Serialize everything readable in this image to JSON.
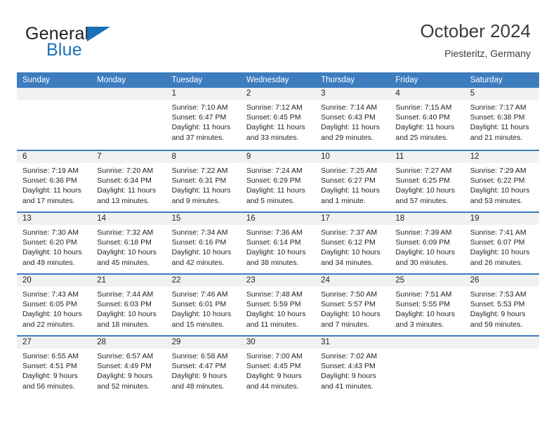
{
  "brand": {
    "name_part1": "General",
    "name_part2": "Blue",
    "accent_color": "#1a71b8"
  },
  "header": {
    "title": "October 2024",
    "location": "Piesteritz, Germany"
  },
  "calendar": {
    "header_bg": "#3d7dbf",
    "daynum_bg": "#f1f1f1",
    "weekday_names": [
      "Sunday",
      "Monday",
      "Tuesday",
      "Wednesday",
      "Thursday",
      "Friday",
      "Saturday"
    ],
    "weeks": [
      [
        {
          "day": "",
          "sunrise": "",
          "sunset": "",
          "daylight": ""
        },
        {
          "day": "",
          "sunrise": "",
          "sunset": "",
          "daylight": ""
        },
        {
          "day": "1",
          "sunrise": "Sunrise: 7:10 AM",
          "sunset": "Sunset: 6:47 PM",
          "daylight": "Daylight: 11 hours and 37 minutes."
        },
        {
          "day": "2",
          "sunrise": "Sunrise: 7:12 AM",
          "sunset": "Sunset: 6:45 PM",
          "daylight": "Daylight: 11 hours and 33 minutes."
        },
        {
          "day": "3",
          "sunrise": "Sunrise: 7:14 AM",
          "sunset": "Sunset: 6:43 PM",
          "daylight": "Daylight: 11 hours and 29 minutes."
        },
        {
          "day": "4",
          "sunrise": "Sunrise: 7:15 AM",
          "sunset": "Sunset: 6:40 PM",
          "daylight": "Daylight: 11 hours and 25 minutes."
        },
        {
          "day": "5",
          "sunrise": "Sunrise: 7:17 AM",
          "sunset": "Sunset: 6:38 PM",
          "daylight": "Daylight: 11 hours and 21 minutes."
        }
      ],
      [
        {
          "day": "6",
          "sunrise": "Sunrise: 7:19 AM",
          "sunset": "Sunset: 6:36 PM",
          "daylight": "Daylight: 11 hours and 17 minutes."
        },
        {
          "day": "7",
          "sunrise": "Sunrise: 7:20 AM",
          "sunset": "Sunset: 6:34 PM",
          "daylight": "Daylight: 11 hours and 13 minutes."
        },
        {
          "day": "8",
          "sunrise": "Sunrise: 7:22 AM",
          "sunset": "Sunset: 6:31 PM",
          "daylight": "Daylight: 11 hours and 9 minutes."
        },
        {
          "day": "9",
          "sunrise": "Sunrise: 7:24 AM",
          "sunset": "Sunset: 6:29 PM",
          "daylight": "Daylight: 11 hours and 5 minutes."
        },
        {
          "day": "10",
          "sunrise": "Sunrise: 7:25 AM",
          "sunset": "Sunset: 6:27 PM",
          "daylight": "Daylight: 11 hours and 1 minute."
        },
        {
          "day": "11",
          "sunrise": "Sunrise: 7:27 AM",
          "sunset": "Sunset: 6:25 PM",
          "daylight": "Daylight: 10 hours and 57 minutes."
        },
        {
          "day": "12",
          "sunrise": "Sunrise: 7:29 AM",
          "sunset": "Sunset: 6:22 PM",
          "daylight": "Daylight: 10 hours and 53 minutes."
        }
      ],
      [
        {
          "day": "13",
          "sunrise": "Sunrise: 7:30 AM",
          "sunset": "Sunset: 6:20 PM",
          "daylight": "Daylight: 10 hours and 49 minutes."
        },
        {
          "day": "14",
          "sunrise": "Sunrise: 7:32 AM",
          "sunset": "Sunset: 6:18 PM",
          "daylight": "Daylight: 10 hours and 45 minutes."
        },
        {
          "day": "15",
          "sunrise": "Sunrise: 7:34 AM",
          "sunset": "Sunset: 6:16 PM",
          "daylight": "Daylight: 10 hours and 42 minutes."
        },
        {
          "day": "16",
          "sunrise": "Sunrise: 7:36 AM",
          "sunset": "Sunset: 6:14 PM",
          "daylight": "Daylight: 10 hours and 38 minutes."
        },
        {
          "day": "17",
          "sunrise": "Sunrise: 7:37 AM",
          "sunset": "Sunset: 6:12 PM",
          "daylight": "Daylight: 10 hours and 34 minutes."
        },
        {
          "day": "18",
          "sunrise": "Sunrise: 7:39 AM",
          "sunset": "Sunset: 6:09 PM",
          "daylight": "Daylight: 10 hours and 30 minutes."
        },
        {
          "day": "19",
          "sunrise": "Sunrise: 7:41 AM",
          "sunset": "Sunset: 6:07 PM",
          "daylight": "Daylight: 10 hours and 26 minutes."
        }
      ],
      [
        {
          "day": "20",
          "sunrise": "Sunrise: 7:43 AM",
          "sunset": "Sunset: 6:05 PM",
          "daylight": "Daylight: 10 hours and 22 minutes."
        },
        {
          "day": "21",
          "sunrise": "Sunrise: 7:44 AM",
          "sunset": "Sunset: 6:03 PM",
          "daylight": "Daylight: 10 hours and 18 minutes."
        },
        {
          "day": "22",
          "sunrise": "Sunrise: 7:46 AM",
          "sunset": "Sunset: 6:01 PM",
          "daylight": "Daylight: 10 hours and 15 minutes."
        },
        {
          "day": "23",
          "sunrise": "Sunrise: 7:48 AM",
          "sunset": "Sunset: 5:59 PM",
          "daylight": "Daylight: 10 hours and 11 minutes."
        },
        {
          "day": "24",
          "sunrise": "Sunrise: 7:50 AM",
          "sunset": "Sunset: 5:57 PM",
          "daylight": "Daylight: 10 hours and 7 minutes."
        },
        {
          "day": "25",
          "sunrise": "Sunrise: 7:51 AM",
          "sunset": "Sunset: 5:55 PM",
          "daylight": "Daylight: 10 hours and 3 minutes."
        },
        {
          "day": "26",
          "sunrise": "Sunrise: 7:53 AM",
          "sunset": "Sunset: 5:53 PM",
          "daylight": "Daylight: 9 hours and 59 minutes."
        }
      ],
      [
        {
          "day": "27",
          "sunrise": "Sunrise: 6:55 AM",
          "sunset": "Sunset: 4:51 PM",
          "daylight": "Daylight: 9 hours and 56 minutes."
        },
        {
          "day": "28",
          "sunrise": "Sunrise: 6:57 AM",
          "sunset": "Sunset: 4:49 PM",
          "daylight": "Daylight: 9 hours and 52 minutes."
        },
        {
          "day": "29",
          "sunrise": "Sunrise: 6:58 AM",
          "sunset": "Sunset: 4:47 PM",
          "daylight": "Daylight: 9 hours and 48 minutes."
        },
        {
          "day": "30",
          "sunrise": "Sunrise: 7:00 AM",
          "sunset": "Sunset: 4:45 PM",
          "daylight": "Daylight: 9 hours and 44 minutes."
        },
        {
          "day": "31",
          "sunrise": "Sunrise: 7:02 AM",
          "sunset": "Sunset: 4:43 PM",
          "daylight": "Daylight: 9 hours and 41 minutes."
        },
        {
          "day": "",
          "sunrise": "",
          "sunset": "",
          "daylight": ""
        },
        {
          "day": "",
          "sunrise": "",
          "sunset": "",
          "daylight": ""
        }
      ]
    ]
  }
}
